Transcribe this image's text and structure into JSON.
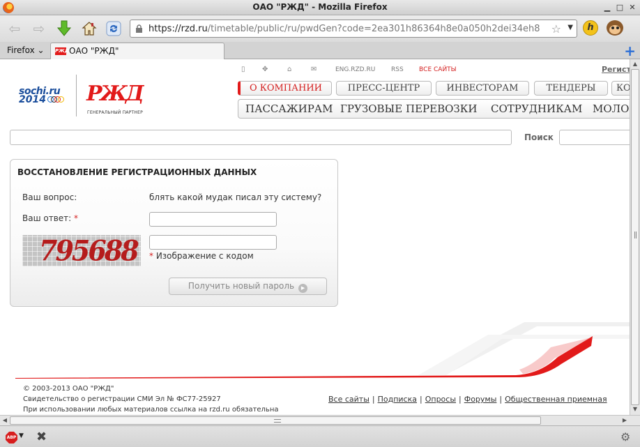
{
  "window": {
    "title": "ОАО \"РЖД\" - Mozilla Firefox"
  },
  "toolbar": {
    "url_host": "https://rzd.ru",
    "url_path": "/timetable/public/ru/pwdGen?code=2ea301h86364h8e0a050h2dei34eh8",
    "addon_h_label": "h"
  },
  "tabs": {
    "firefox_menu": "Firefox",
    "active_tab": "ОАО \"РЖД\"",
    "favicon_text": "РЖД"
  },
  "site": {
    "logo_sochi_line1": "sochi.ru",
    "logo_sochi_line2": "2014",
    "logo_rzd": "РЖД",
    "logo_rzd_sub": "ГЕНЕРАЛЬНЫЙ ПАРТНЕР",
    "top_links": {
      "eng": "ENG.RZD.RU",
      "rss": "RSS",
      "all_sites": "ВСЕ САЙТЫ",
      "register": "Регистрация"
    },
    "menu_top": [
      "О КОМПАНИИ",
      "ПРЕСС-ЦЕНТР",
      "ИНВЕСТОРАМ",
      "ТЕНДЕРЫ",
      "КОНТАКТЫ"
    ],
    "menu_main": [
      "ПАССАЖИРАМ",
      "ГРУЗОВЫЕ ПЕРЕВОЗКИ",
      "СОТРУДНИКАМ",
      "МОЛОДЁЖИ"
    ],
    "search_label": "Поиск"
  },
  "form": {
    "title": "ВОССТАНОВЛЕНИЕ РЕГИСТРАЦИОННЫХ ДАННЫХ",
    "question_label": "Ваш вопрос:",
    "question_text": "блять какой мудак писал эту систему?",
    "answer_label": "Ваш ответ:",
    "required_mark": "*",
    "captcha_text": "795688",
    "captcha_hint": "Изображение с кодом",
    "submit_label": "Получить новый пароль"
  },
  "footer": {
    "copyright": "© 2003-2013 ОАО \"РЖД\"",
    "registration": "Свидетельство о регистрации СМИ Эл № ФС77-25927",
    "notice": "При использовании любых материалов ссылка на rzd.ru обязательна",
    "links": [
      "Все сайты",
      "Подписка",
      "Опросы",
      "Форумы",
      "Общественная приемная"
    ],
    "separator": "|"
  },
  "statusbar": {
    "abp_label": "ABP"
  },
  "colors": {
    "brand_red": "#e21a1a",
    "link_red": "#d41f1f",
    "sochi_blue": "#1b4e9c"
  }
}
